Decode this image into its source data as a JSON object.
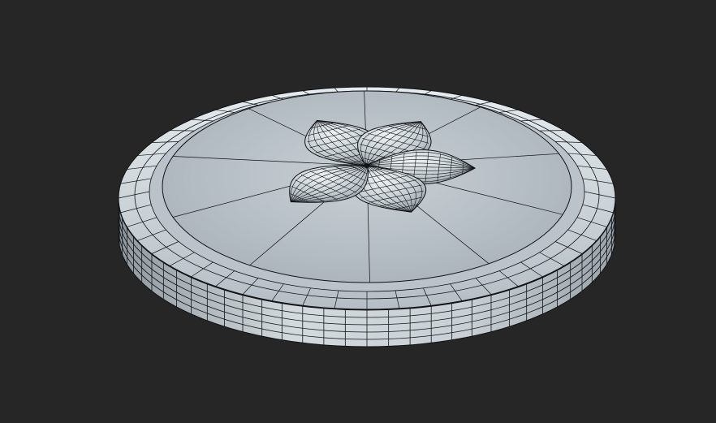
{
  "viewport": {
    "background": "#262626",
    "object": "wireframe-rosette-medallion",
    "render_style": "shaded-with-wireframe-edges"
  },
  "colors": {
    "surface_light": "#d9e1e6",
    "surface_mid": "#aeb9c0",
    "surface_dark": "#6f7a80",
    "wire": "#101214"
  },
  "model": {
    "petal_count": 5,
    "rim_rings": 2
  }
}
